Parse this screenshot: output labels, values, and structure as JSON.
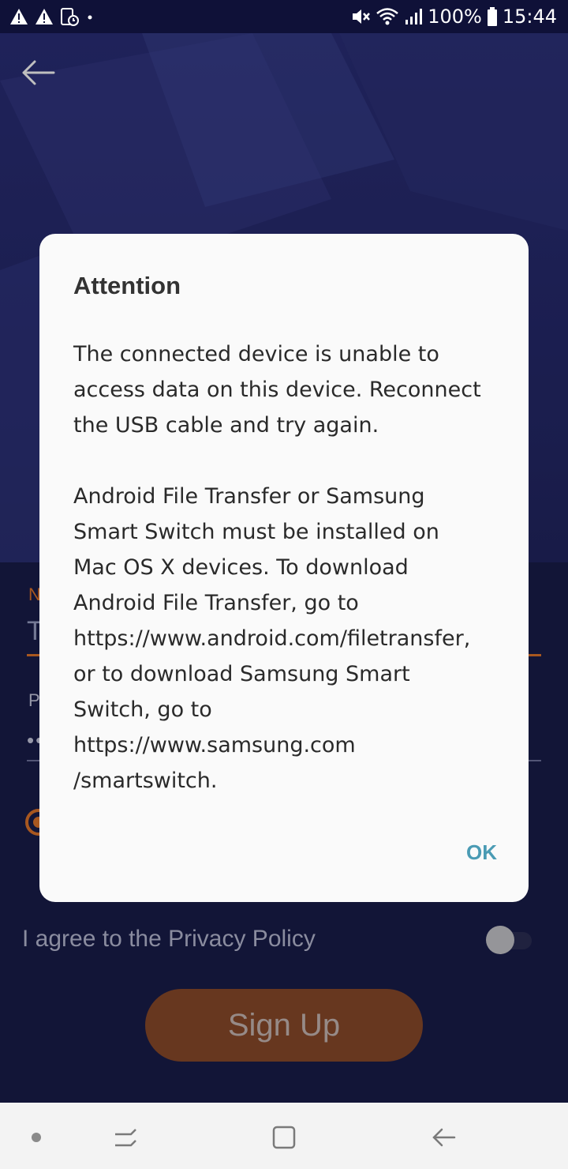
{
  "status_bar": {
    "battery": "100%",
    "time": "15:44",
    "icons_left": [
      "warning-icon",
      "warning-icon",
      "screen-record-icon",
      "dot-icon"
    ],
    "icons_right": [
      "mute-icon",
      "wifi-icon",
      "signal-icon",
      "battery-icon"
    ]
  },
  "form": {
    "name_label_partial": "N",
    "name_input_partial": "T",
    "password_label_partial": "P",
    "password_value_partial": "••"
  },
  "privacy": {
    "label": "I agree to the Privacy Policy",
    "toggle_on": false
  },
  "signup_button": "Sign Up",
  "dialog": {
    "title": "Attention",
    "paragraphs": [
      "The connected device is unable to\naccess data on this device. Reconnect\nthe USB cable and try again.",
      "Android File Transfer or Samsung\nSmart Switch must be installed on\nMac OS X devices. To download\nAndroid File Transfer, go to\nhttps://www.android.com/filetransfer,\nor to download Samsung Smart\nSwitch, go to\nhttps://www.samsung.com\n/smartswitch."
    ],
    "ok_label": "OK"
  },
  "colors": {
    "accent": "#e0752a",
    "dialog_button": "#4a9bb4",
    "background": "#1c1f52"
  }
}
